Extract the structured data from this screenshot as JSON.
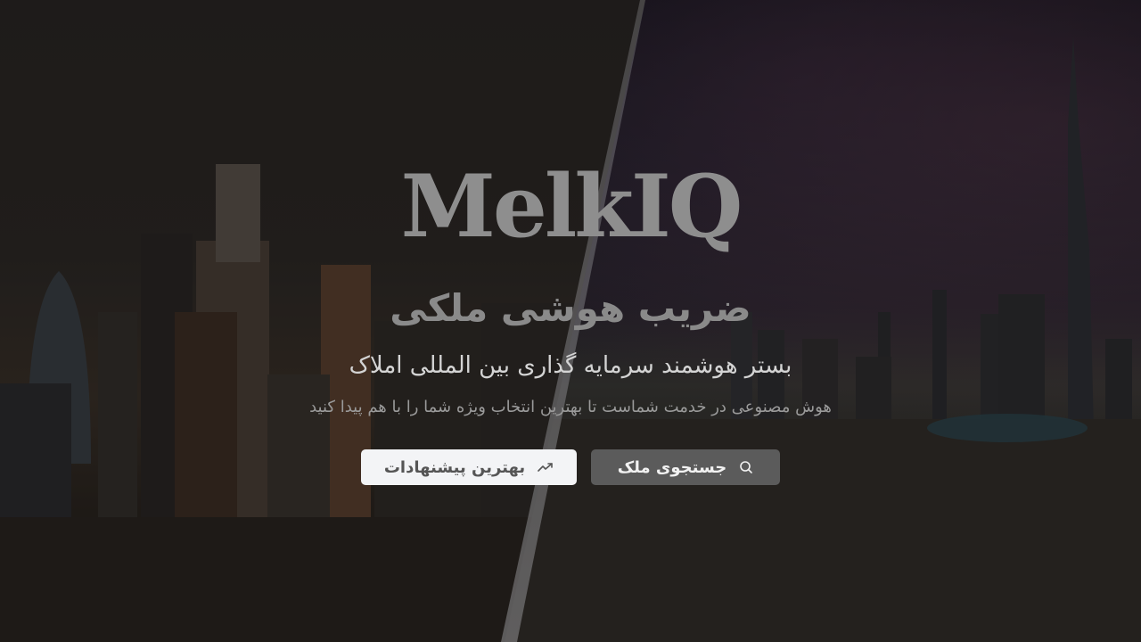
{
  "hero": {
    "brand": "MelkIQ",
    "headline": "ضریب هوشی ملکی",
    "subtitle": "بستر هوشمند سرمایه گذاری بین المللی املاک",
    "tagline": "هوش مصنوعی در خدمت شماست تا بهترین انتخاب ویژه شما را با هم پیدا کنید"
  },
  "actions": {
    "search_label": "جستجوی ملک",
    "search_icon": "search-icon",
    "offers_label": "بهترین پیشنهادات",
    "offers_icon": "trending-up-icon"
  },
  "colors": {
    "primary_button": "#5b5b5b",
    "secondary_button": "#f3f4f6"
  }
}
